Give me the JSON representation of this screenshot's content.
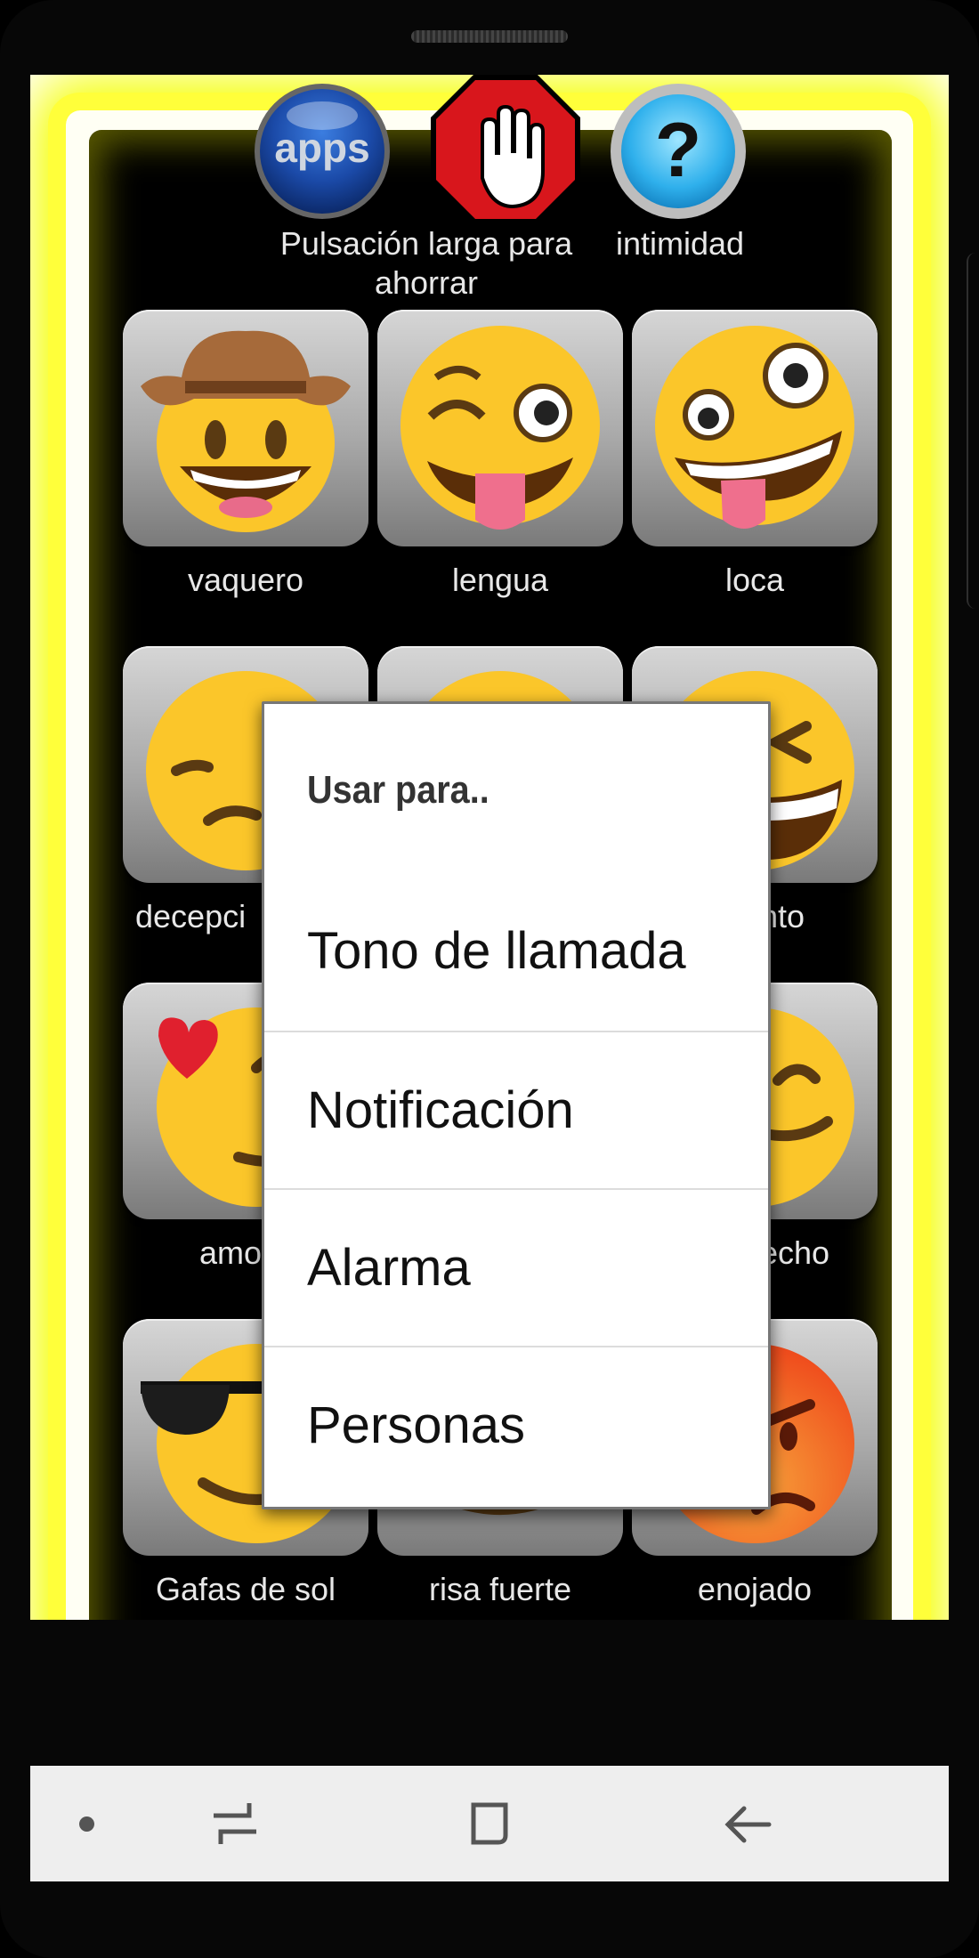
{
  "top_bar": {
    "apps_label_text": "apps",
    "stop_caption": "Pulsación larga para ahorrar",
    "privacy_caption": "intimidad"
  },
  "grid": {
    "rows": [
      [
        "vaquero",
        "lengua",
        "loca"
      ],
      [
        "decepci",
        "",
        "ento"
      ],
      [
        "amo",
        "",
        "echo"
      ],
      [
        "Gafas de sol",
        "risa fuerte",
        "enojado"
      ]
    ]
  },
  "dialog": {
    "title": "Usar para..",
    "items": [
      "Tono de llamada",
      "Notificación",
      "Alarma",
      "Personas"
    ]
  },
  "colors": {
    "glow": "#f4ff00",
    "emoji_yellow": "#fbc62a",
    "angry_red": "#f04a1e"
  }
}
